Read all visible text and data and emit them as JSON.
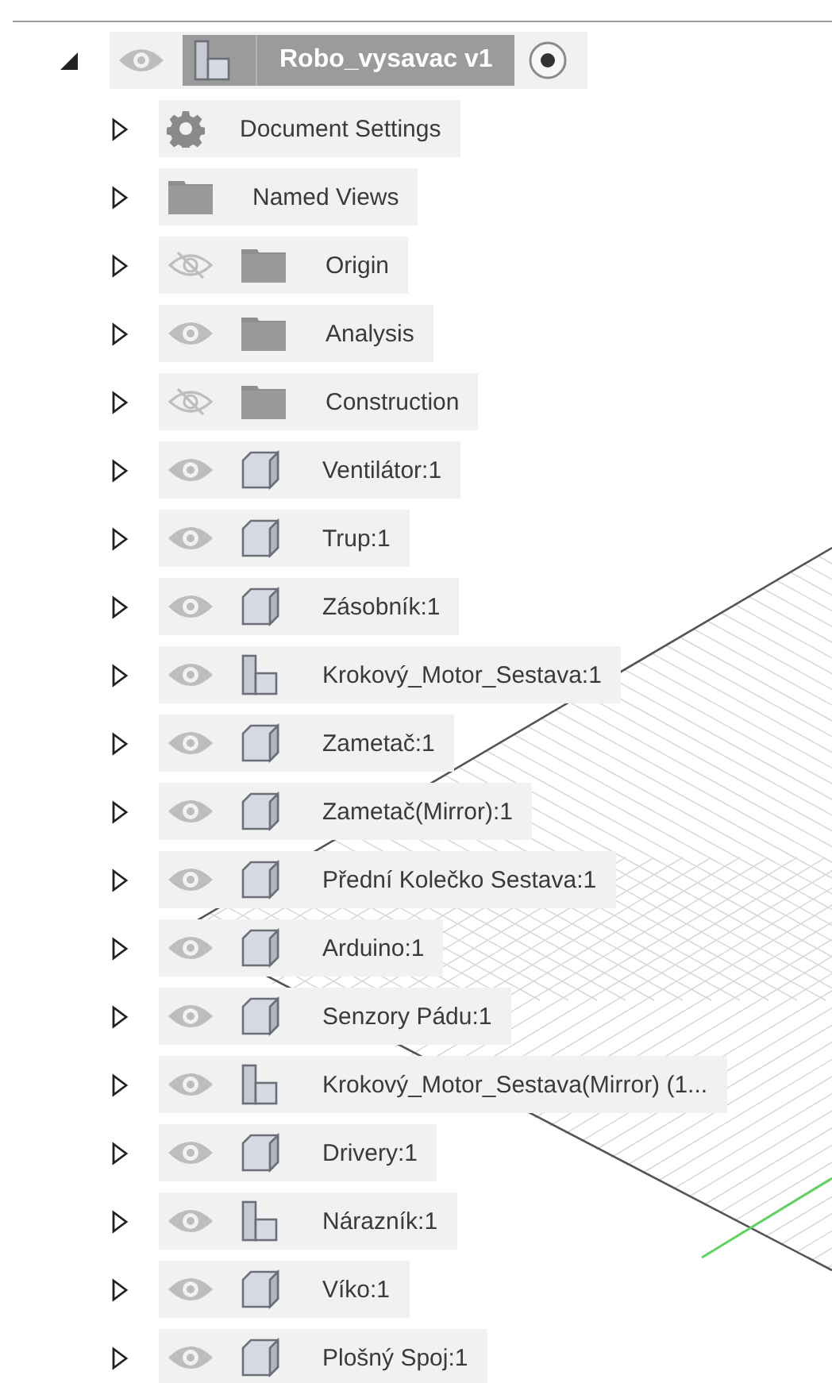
{
  "root": {
    "label": "Robo_vysavac v1",
    "expanded": true,
    "visible": true,
    "selected": true,
    "active": true
  },
  "items": [
    {
      "kind": "settings",
      "label": "Document Settings",
      "expanded": false
    },
    {
      "kind": "folder",
      "label": "Named Views",
      "expanded": false
    },
    {
      "kind": "folder",
      "label": "Origin",
      "expanded": false,
      "visible": false
    },
    {
      "kind": "folder",
      "label": "Analysis",
      "expanded": false,
      "visible": true
    },
    {
      "kind": "folder",
      "label": "Construction",
      "expanded": false,
      "visible": false
    },
    {
      "kind": "body",
      "label": "Ventilátor:1",
      "expanded": false,
      "visible": true
    },
    {
      "kind": "body",
      "label": "Trup:1",
      "expanded": false,
      "visible": true
    },
    {
      "kind": "body",
      "label": "Zásobník:1",
      "expanded": false,
      "visible": true
    },
    {
      "kind": "assembly",
      "label": "Krokový_Motor_Sestava:1",
      "expanded": false,
      "visible": true
    },
    {
      "kind": "body",
      "label": "Zametač:1",
      "expanded": false,
      "visible": true
    },
    {
      "kind": "body",
      "label": "Zametač(Mirror):1",
      "expanded": false,
      "visible": true
    },
    {
      "kind": "body",
      "label": "Přední Kolečko Sestava:1",
      "expanded": false,
      "visible": true
    },
    {
      "kind": "body",
      "label": "Arduino:1",
      "expanded": false,
      "visible": true
    },
    {
      "kind": "body",
      "label": "Senzory Pádu:1",
      "expanded": false,
      "visible": true
    },
    {
      "kind": "assembly",
      "label": "Krokový_Motor_Sestava(Mirror) (1...",
      "expanded": false,
      "visible": true
    },
    {
      "kind": "body",
      "label": "Drivery:1",
      "expanded": false,
      "visible": true
    },
    {
      "kind": "assembly",
      "label": "Nárazník:1",
      "expanded": false,
      "visible": true
    },
    {
      "kind": "body",
      "label": "Víko:1",
      "expanded": false,
      "visible": true
    },
    {
      "kind": "body",
      "label": "Plošný Spoj:1",
      "expanded": false,
      "visible": true
    }
  ]
}
